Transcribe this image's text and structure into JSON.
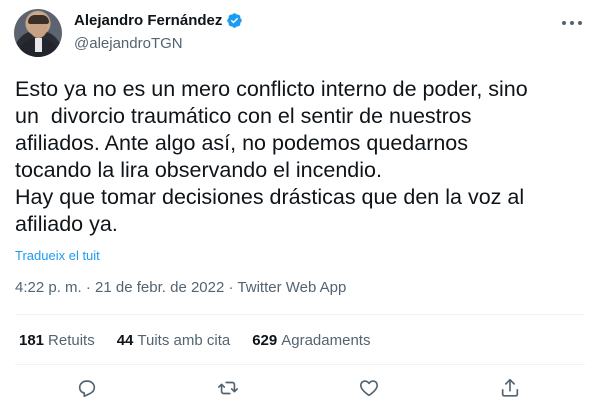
{
  "author": {
    "name": "Alejandro Fernández",
    "handle": "@alejandroTGN",
    "verified": true
  },
  "tweet": {
    "lines": [
      "Esto ya no es un mero conflicto interno de poder, sino",
      "un  divorcio traumático con el sentir de nuestros",
      "afiliados. Ante algo así, no podemos quedarnos",
      "tocando la lira observando el incendio.",
      "Hay que tomar decisiones drásticas que den la voz al",
      "afiliado ya."
    ],
    "translate_label": "Tradueix el tuit",
    "time": "4:22 p. m.",
    "separator": "·",
    "date": "21 de febr. de 2022",
    "source": "Twitter Web App"
  },
  "stats": {
    "retweets_count": "181",
    "retweets_label": "Retuits",
    "quotes_count": "44",
    "quotes_label": "Tuits amb cita",
    "likes_count": "629",
    "likes_label": "Agradaments"
  },
  "icons": {
    "verified": "verified-badge-icon",
    "more": "more-options-icon",
    "reply": "reply-icon",
    "retweet": "retweet-icon",
    "like": "heart-icon",
    "share": "share-icon"
  },
  "colors": {
    "text": "#0f1419",
    "secondary": "#536471",
    "accent": "#1d9bf0",
    "divider": "#eff3f4"
  }
}
